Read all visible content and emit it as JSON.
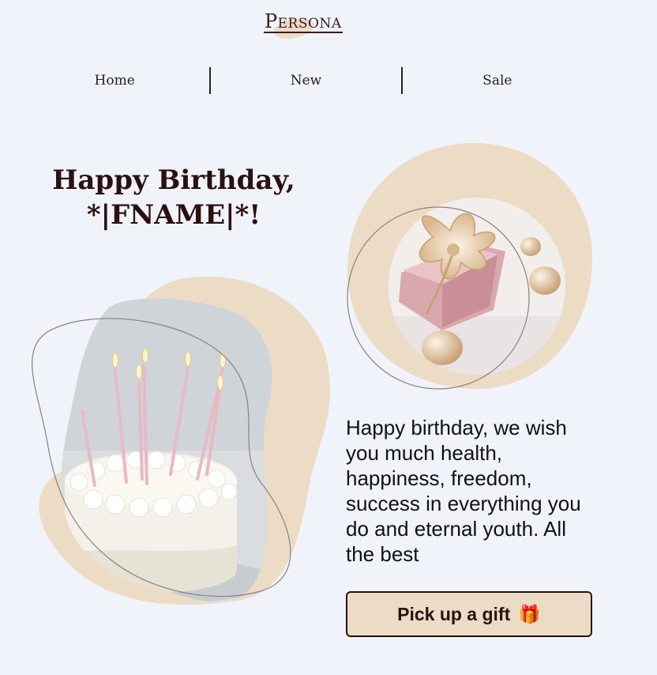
{
  "brand": {
    "logo": "Persona"
  },
  "nav": {
    "items": [
      {
        "label": "Home"
      },
      {
        "label": "New"
      },
      {
        "label": "Sale"
      }
    ]
  },
  "hero": {
    "headline": "Happy Birthday, *|FNAME|*!"
  },
  "message": {
    "text": "Happy birthday, we wish you much health, happiness, freedom, success in everything you do and eternal youth. All the best"
  },
  "cta": {
    "label": "Pick up a gift",
    "emoji": "🎁"
  },
  "colors": {
    "background": "#f0f3f9",
    "accent_beige": "#ecdcc6",
    "dark_brown": "#2b1010"
  },
  "images": {
    "cake": "birthday-cake-with-candles",
    "gift": "gift-box-with-ribbon"
  }
}
